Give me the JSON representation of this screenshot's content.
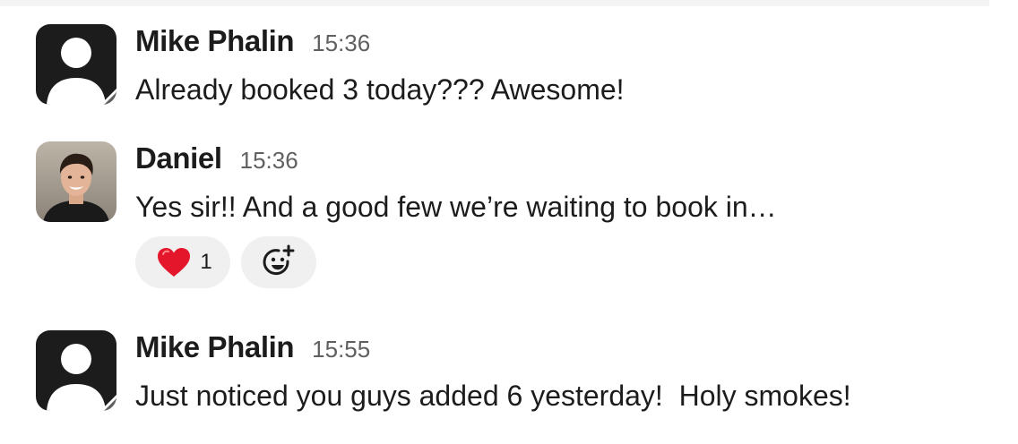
{
  "messages": [
    {
      "author": "Mike Phalin",
      "time": "15:36",
      "text": "Already booked 3 today??? Awesome!",
      "avatar": "default-user-icon"
    },
    {
      "author": "Daniel",
      "time": "15:36",
      "text": "Yes sir!! And a good few we’re waiting to book in…",
      "avatar": "profile-photo",
      "reactions": [
        {
          "emoji": "heart-emoji",
          "count": "1"
        }
      ]
    },
    {
      "author": "Mike Phalin",
      "time": "15:55",
      "text": "Just noticed you guys added 6 yesterday!  Holy smokes!",
      "avatar": "default-user-icon"
    }
  ],
  "colors": {
    "text": "#1d1c1d",
    "timestamp": "#616061",
    "reaction_bg": "#f0f0f0",
    "default_avatar_bg": "#1d1c1d"
  }
}
